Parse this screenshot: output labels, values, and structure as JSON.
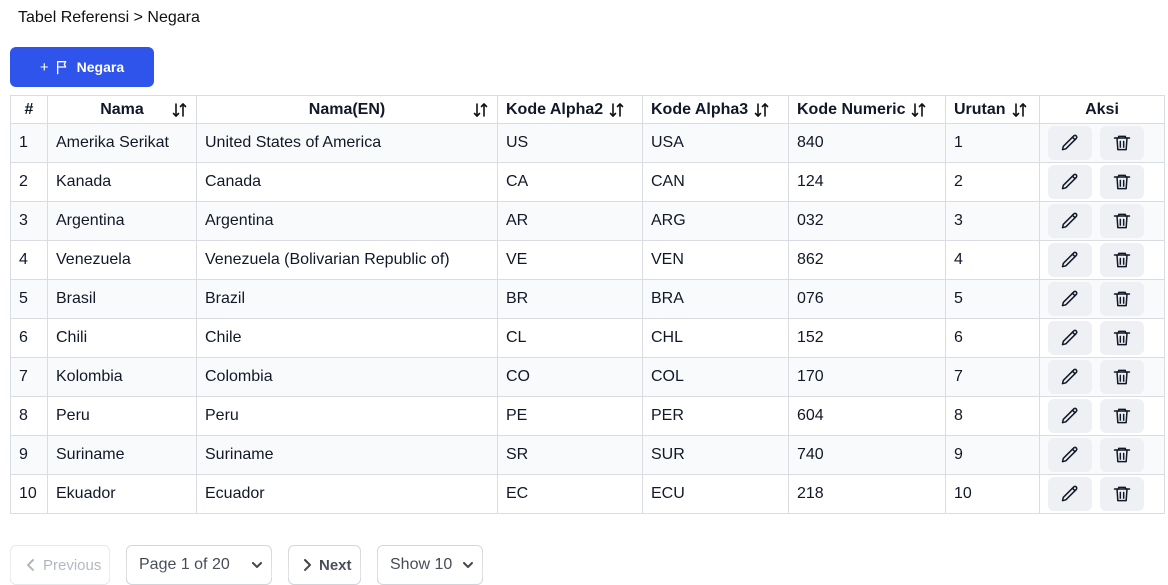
{
  "breadcrumb": "Tabel Referensi > Negara",
  "add_button": {
    "plus": "+",
    "label": "Negara"
  },
  "table": {
    "headers": [
      "#",
      "Nama",
      "Nama(EN)",
      "Kode Alpha2",
      "Kode Alpha3",
      "Kode Numeric",
      "Urutan",
      "Aksi"
    ],
    "rows": [
      [
        "1",
        "Amerika Serikat",
        "United States of America",
        "US",
        "USA",
        "840",
        "1"
      ],
      [
        "2",
        "Kanada",
        "Canada",
        "CA",
        "CAN",
        "124",
        "2"
      ],
      [
        "3",
        "Argentina",
        "Argentina",
        "AR",
        "ARG",
        "032",
        "3"
      ],
      [
        "4",
        "Venezuela",
        "Venezuela (Bolivarian Republic of)",
        "VE",
        "VEN",
        "862",
        "4"
      ],
      [
        "5",
        "Brasil",
        "Brazil",
        "BR",
        "BRA",
        "076",
        "5"
      ],
      [
        "6",
        "Chili",
        "Chile",
        "CL",
        "CHL",
        "152",
        "6"
      ],
      [
        "7",
        "Kolombia",
        "Colombia",
        "CO",
        "COL",
        "170",
        "7"
      ],
      [
        "8",
        "Peru",
        "Peru",
        "PE",
        "PER",
        "604",
        "8"
      ],
      [
        "9",
        "Suriname",
        "Suriname",
        "SR",
        "SUR",
        "740",
        "9"
      ],
      [
        "10",
        "Ekuador",
        "Ecuador",
        "EC",
        "ECU",
        "218",
        "10"
      ]
    ]
  },
  "pagination": {
    "previous": "Previous",
    "page": "Page 1 of 20",
    "next": "Next",
    "show": "Show 10"
  },
  "colors": {
    "primary": "#2f54eb",
    "border": "#d9dde3",
    "row_alt": "#f9fafb",
    "action_bg": "#eef0f3"
  },
  "icons": {
    "add": "flag-icon",
    "sort": "sort-arrows-icon",
    "edit": "pencil-icon",
    "delete": "trash-icon"
  }
}
